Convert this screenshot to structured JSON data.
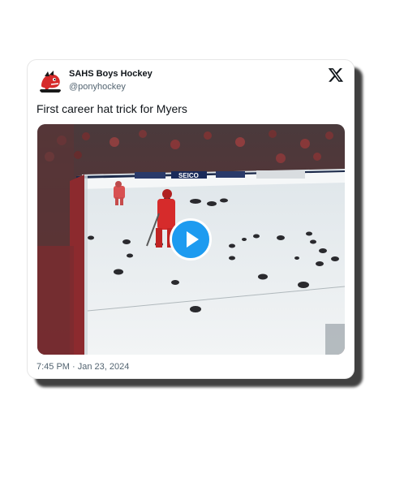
{
  "tweet": {
    "author_name": "SAHS Boys Hockey",
    "author_handle": "@ponyhockey",
    "text": "First career hat trick for Myers",
    "timestamp": "7:45 PM · Jan 23, 2024",
    "media": {
      "kind": "video",
      "board_ads": [
        "SEICO"
      ]
    }
  },
  "icons": {
    "brand": "x-logo-icon",
    "play": "play-icon",
    "avatar": "pony-mascot-avatar"
  },
  "colors": {
    "accent": "#1d9bf0",
    "text_primary": "#0f1419",
    "text_secondary": "#536471",
    "team_red": "#d62b2b"
  }
}
